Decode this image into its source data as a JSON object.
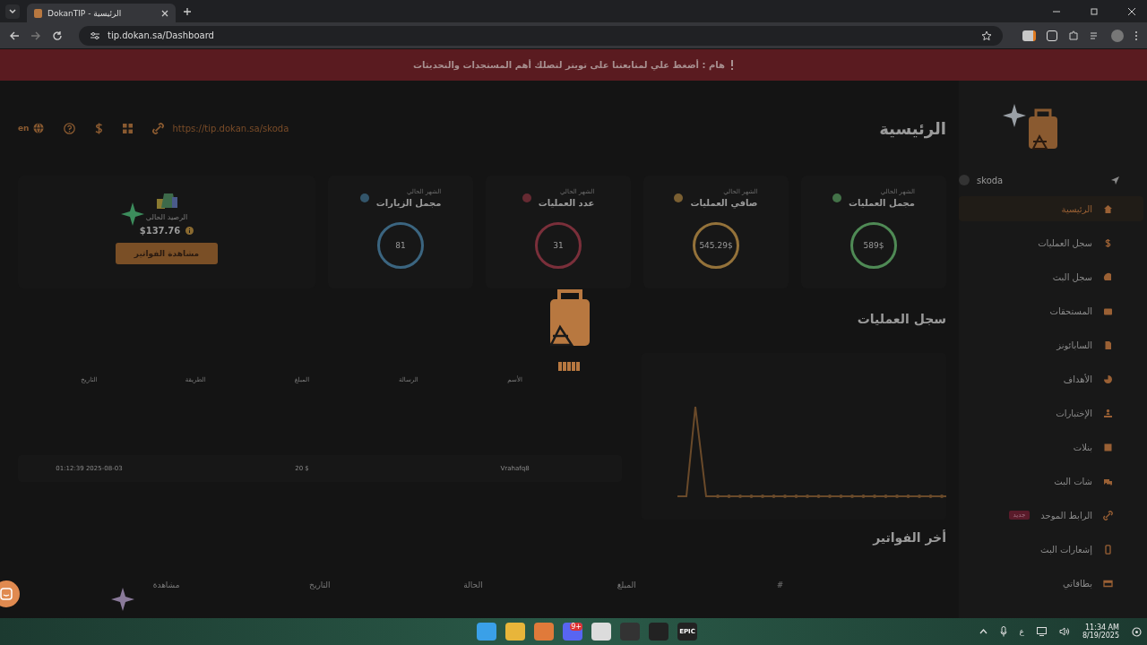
{
  "browser": {
    "tab_title": "DokanTIP - الرئيسية",
    "url": "tip.dokan.sa/Dashboard"
  },
  "banner": {
    "text": "هام : أضغط علي لمتابعتنا على تويتر لتصلك أهم المستجدات والتحديثات"
  },
  "header": {
    "title": "الرئيسية",
    "link": "https://tip.dokan.sa/skoda",
    "language": "en"
  },
  "stats": [
    {
      "caption": "الشهر الحالي",
      "title": "مجمل العمليات",
      "value": "589$",
      "color": "#4f8a55"
    },
    {
      "caption": "الشهر الحالي",
      "title": "صافي العمليات",
      "value": "545.29$",
      "color": "#94723a"
    },
    {
      "caption": "الشهر الحالي",
      "title": "عدد العمليات",
      "value": "31",
      "color": "#7a2f3a"
    },
    {
      "caption": "الشهر الحالي",
      "title": "مجمل الزيارات",
      "value": "81",
      "color": "#3b6580"
    }
  ],
  "balance": {
    "caption": "الرصيد الحالي",
    "amount": "$137.76",
    "button": "مشاهدة الفواتير"
  },
  "transactions": {
    "title": "سجل العمليات",
    "columns": [
      "الأسم",
      "الرسالة",
      "المبلغ",
      "الطريقة",
      "التاريخ"
    ],
    "rows": [
      {
        "name": "Vrahafq8",
        "amount": "$ 20",
        "date": "01:12:39 2025-08-03"
      }
    ]
  },
  "invoices": {
    "title": "أخر الفواتير",
    "columns": [
      "#",
      "المبلغ",
      "الحالة",
      "التاريخ",
      "مشاهدة"
    ]
  },
  "sidebar": {
    "user": "skoda",
    "items": [
      {
        "label": "الرئيسية",
        "selected": true
      },
      {
        "label": "سجل العمليات",
        "selected": false
      },
      {
        "label": "سجل البث",
        "selected": false
      },
      {
        "label": "المستحقات",
        "selected": false
      },
      {
        "label": "السابائونز",
        "selected": false
      },
      {
        "label": "الأهداف",
        "selected": false
      },
      {
        "label": "الإختبارات",
        "selected": false
      },
      {
        "label": "بنلات",
        "selected": false
      },
      {
        "label": "شات البث",
        "selected": false
      },
      {
        "label": "الرابط الموحد",
        "selected": false,
        "badge": "جديد"
      },
      {
        "label": "إشعارات البث",
        "selected": false
      },
      {
        "label": "بطاقاتي",
        "selected": false
      }
    ]
  },
  "taskbar": {
    "apps": [
      {
        "kind": "windows"
      },
      {
        "kind": "folder"
      },
      {
        "kind": "app"
      },
      {
        "kind": "discord",
        "badge": "9+"
      },
      {
        "kind": "chrome"
      },
      {
        "kind": "obs"
      },
      {
        "kind": "tool"
      },
      {
        "kind": "epic",
        "label": "EPIC"
      }
    ],
    "input_language": "ع",
    "time": "11:34 AM",
    "date": "8/19/2025"
  }
}
